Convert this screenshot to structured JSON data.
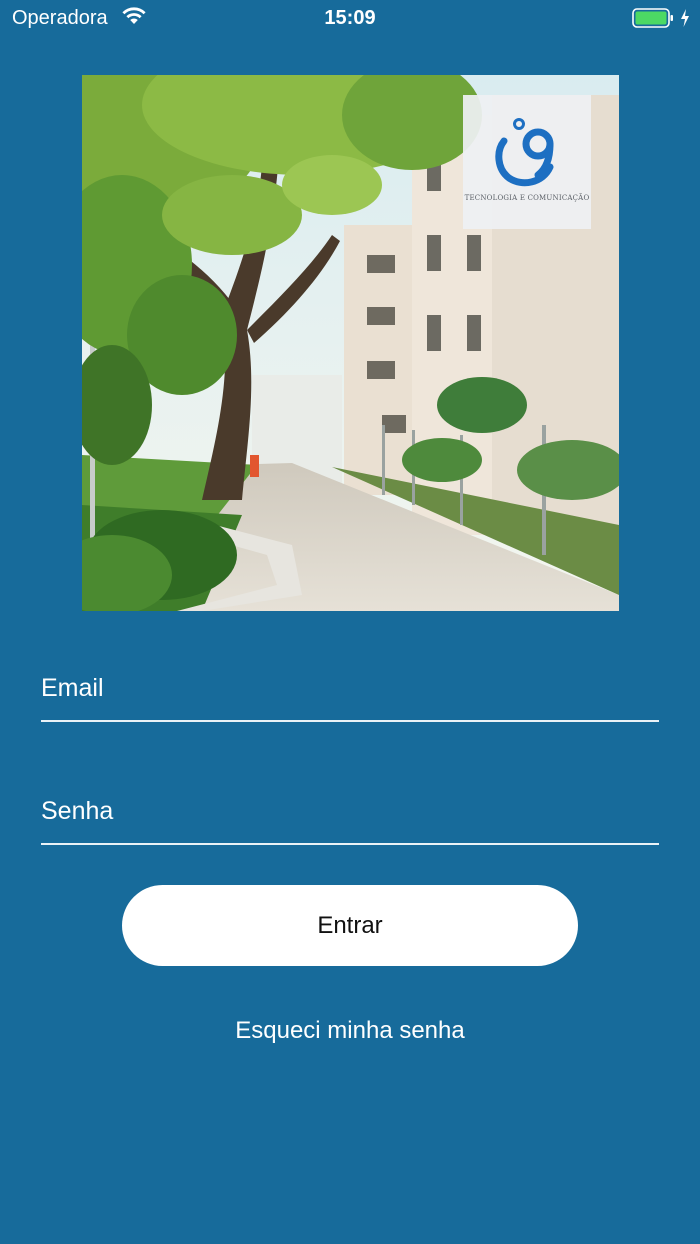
{
  "status_bar": {
    "carrier": "Operadora",
    "time": "15:09",
    "icons": [
      "wifi-icon",
      "battery-icon",
      "charging-bolt-icon"
    ],
    "battery_color": "#4cd964"
  },
  "hero": {
    "image": "campus-walkway-photo",
    "logo": {
      "mark": "i9",
      "tagline": "TECNOLOGIA E COMUNICAÇÃO"
    }
  },
  "form": {
    "email_placeholder": "Email",
    "password_placeholder": "Senha",
    "submit_label": "Entrar",
    "forgot_label": "Esqueci minha senha"
  },
  "colors": {
    "background": "#176b9b",
    "button": "#ffffff",
    "logo_blue": "#1d6fc2"
  }
}
